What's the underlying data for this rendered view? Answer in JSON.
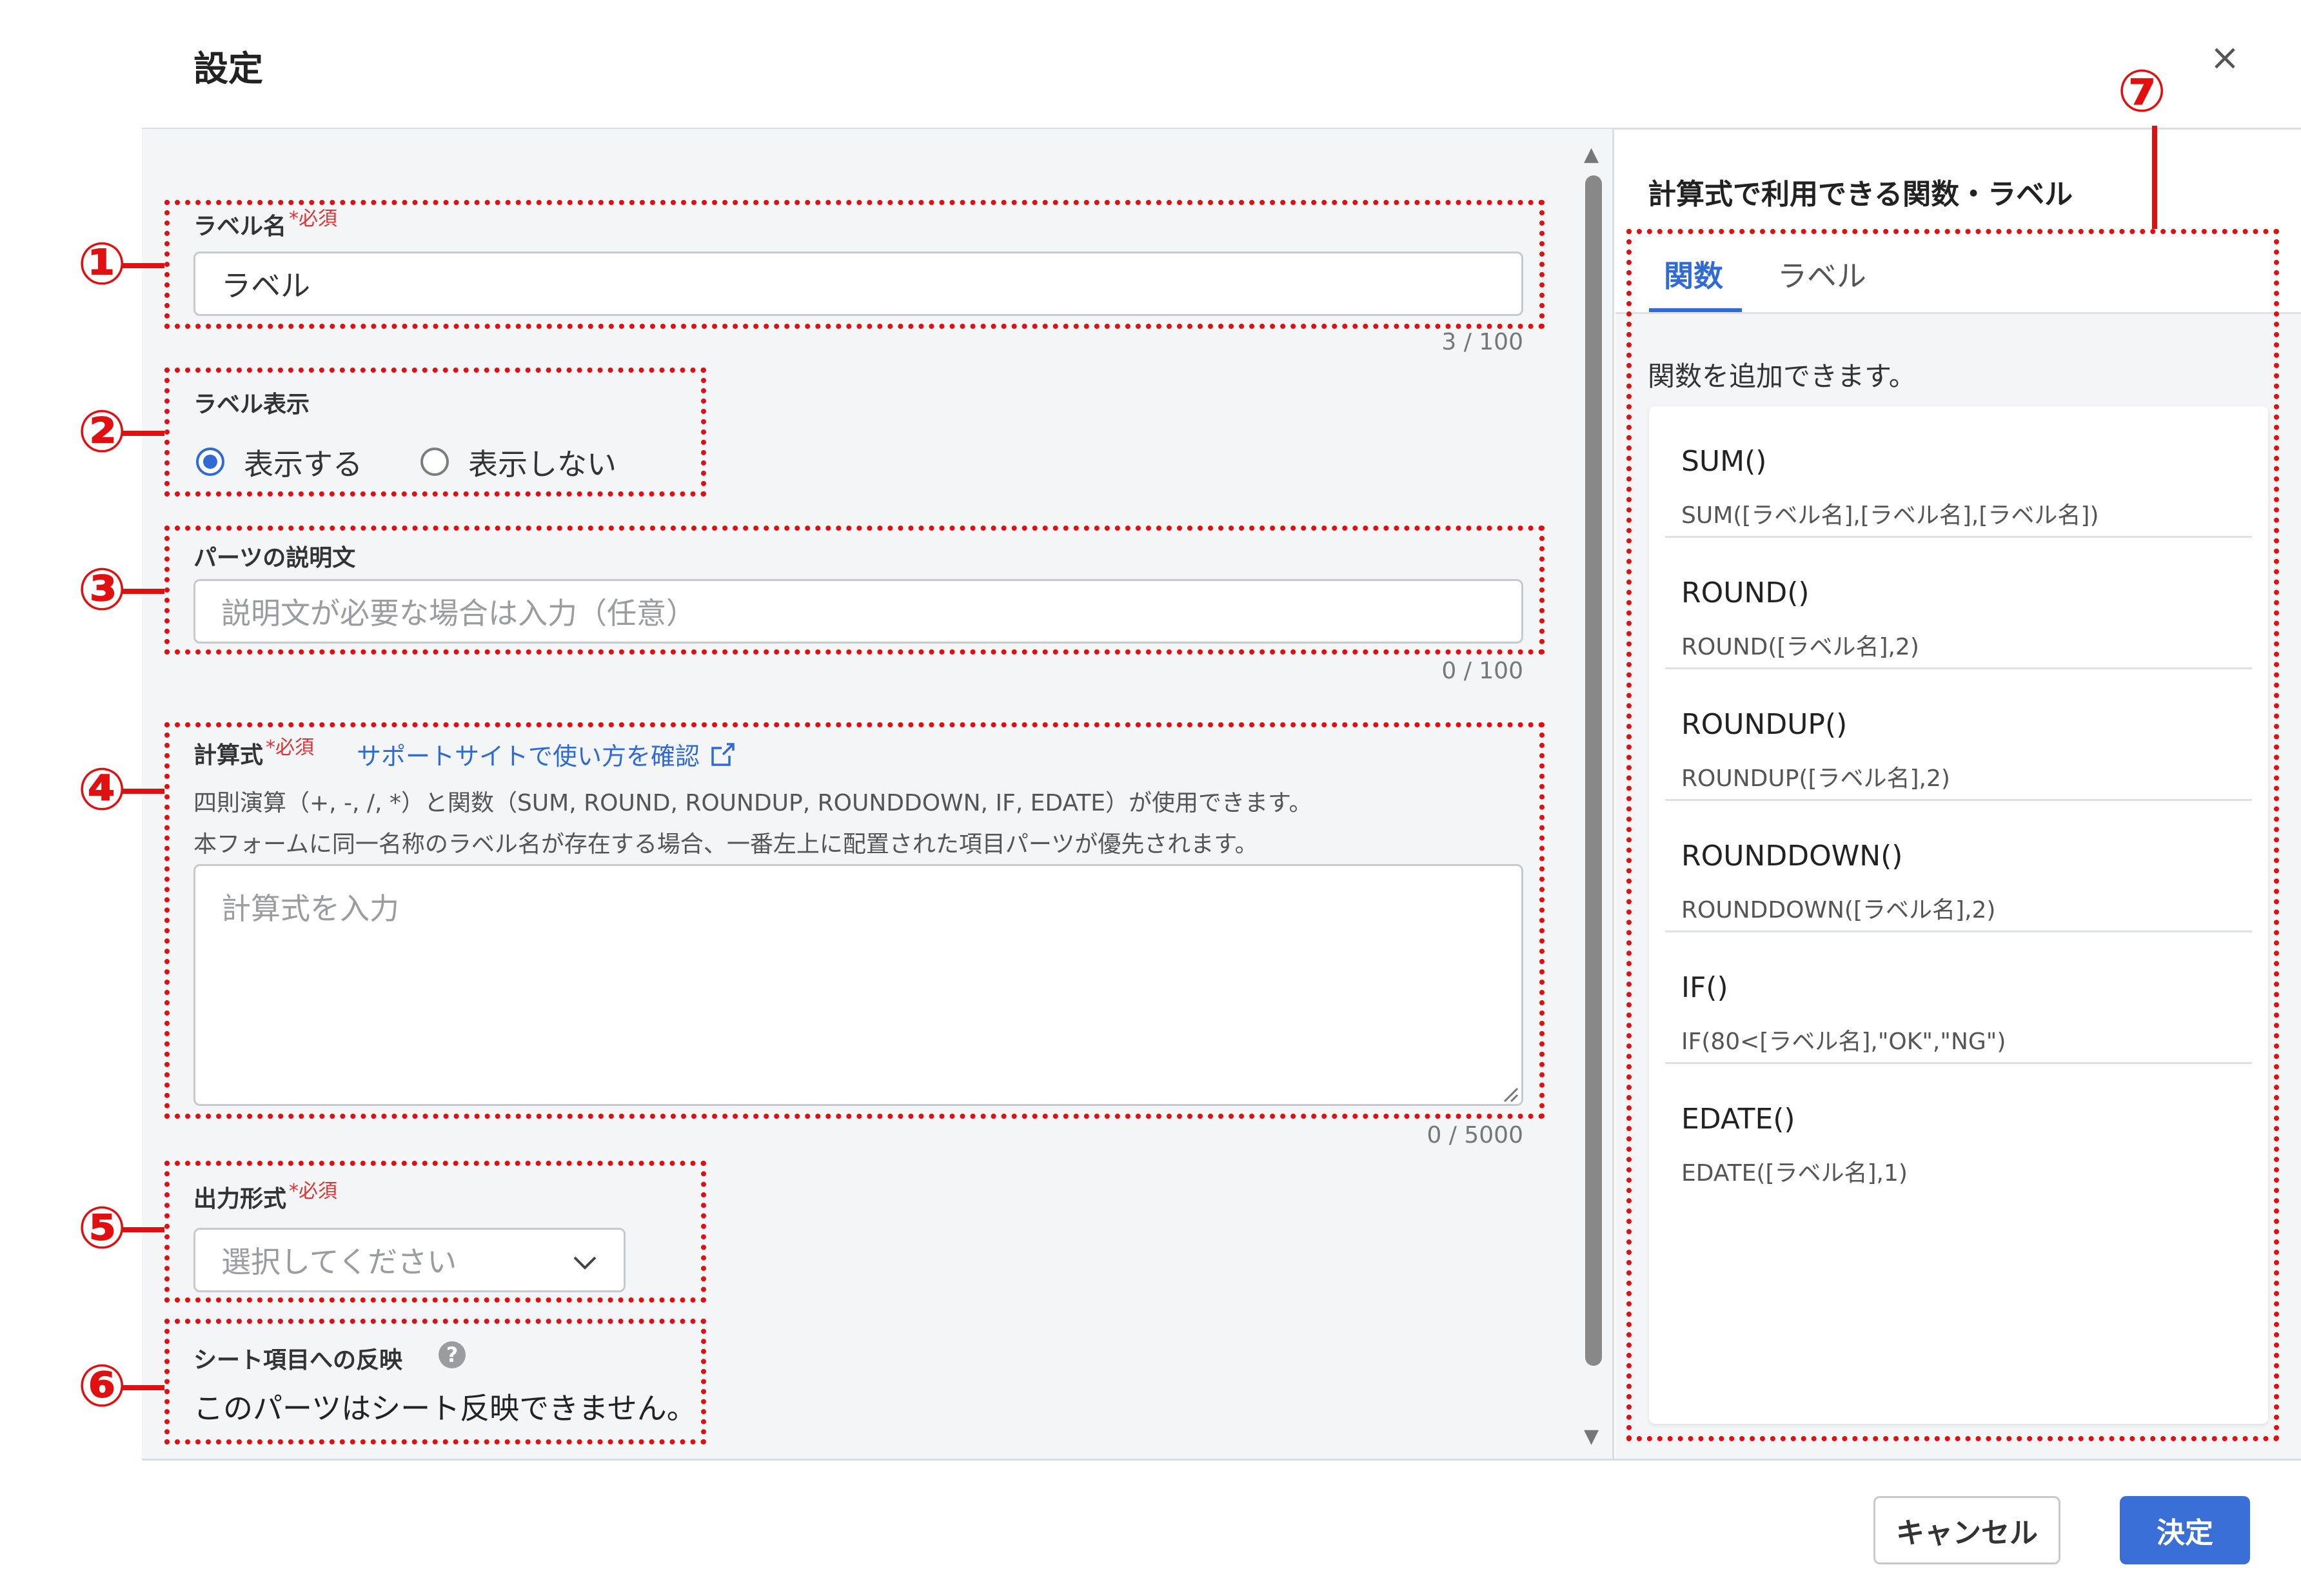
{
  "dialog": {
    "title": "設定",
    "close_glyph": "×"
  },
  "callouts": [
    "①",
    "②",
    "③",
    "④",
    "⑤",
    "⑥",
    "⑦"
  ],
  "label_name": {
    "label": "ラベル名",
    "required_mark": "*必須",
    "value": "ラベル",
    "counter": "3 / 100"
  },
  "label_display": {
    "label": "ラベル表示",
    "options": [
      "表示する",
      "表示しない"
    ],
    "selected": "表示する"
  },
  "description": {
    "label": "パーツの説明文",
    "placeholder": "説明文が必要な場合は入力（任意）",
    "counter": "0 / 100"
  },
  "formula": {
    "label": "計算式",
    "required_mark": "*必須",
    "support_link": "サポートサイトで使い方を確認",
    "help_line1": "四則演算（+, -, /, *）と関数（SUM, ROUND, ROUNDUP, ROUNDDOWN, IF, EDATE）が使用できます。",
    "help_line2": "本フォームに同一名称のラベル名が存在する場合、一番左上に配置された項目パーツが優先されます。",
    "placeholder": "計算式を入力",
    "counter": "0 / 5000"
  },
  "output_format": {
    "label": "出力形式",
    "required_mark": "*必須",
    "placeholder": "選択してください"
  },
  "sheet_reflect": {
    "label": "シート項目への反映",
    "message": "このパーツはシート反映できません。"
  },
  "right_panel": {
    "title": "計算式で利用できる関数・ラベル",
    "tabs": [
      "関数",
      "ラベル"
    ],
    "active_tab": "関数",
    "intro": "関数を追加できます。",
    "functions": [
      {
        "name": "SUM()",
        "example": "SUM([ラベル名],[ラベル名],[ラベル名])"
      },
      {
        "name": "ROUND()",
        "example": "ROUND([ラベル名],2)"
      },
      {
        "name": "ROUNDUP()",
        "example": "ROUNDUP([ラベル名],2)"
      },
      {
        "name": "ROUNDDOWN()",
        "example": "ROUNDDOWN([ラベル名],2)"
      },
      {
        "name": "IF()",
        "example": "IF(80<[ラベル名],\"OK\",\"NG\")"
      },
      {
        "name": "EDATE()",
        "example": "EDATE([ラベル名],1)"
      }
    ]
  },
  "footer": {
    "cancel": "キャンセル",
    "ok": "決定"
  },
  "colors": {
    "accent": "#2f6ad6",
    "annotation": "#e01010",
    "required": "#dd3333"
  }
}
